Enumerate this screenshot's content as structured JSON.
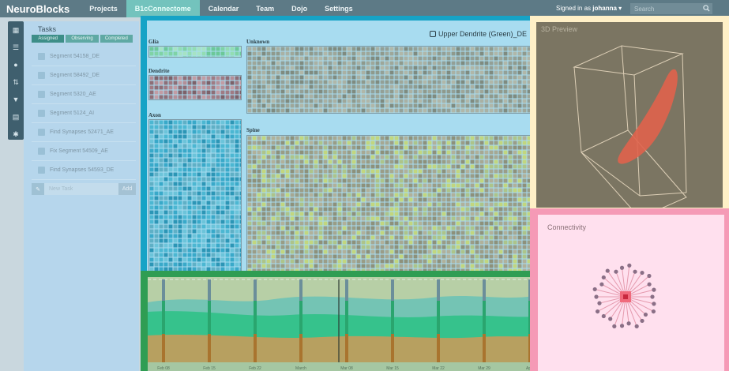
{
  "nav": {
    "brand": "NeuroBlocks",
    "items": [
      "Projects",
      "B1cConnectome",
      "Calendar",
      "Team",
      "Dojo",
      "Settings"
    ],
    "active": "B1cConnectome",
    "signed_in_prefix": "Signed in as",
    "user": "johanna",
    "search_placeholder": "Search"
  },
  "rail": {
    "icons": [
      "grid-icon",
      "list-icon",
      "drop-icon",
      "sort-icon",
      "filter-icon",
      "book-icon",
      "gear-icon"
    ]
  },
  "tasks": {
    "title": "Tasks",
    "tabs": [
      "Assigned",
      "Observing",
      "Completed"
    ],
    "active_tab": "Assigned",
    "items": [
      "Segment 54158_DE",
      "Segment 58492_DE",
      "Segment 5320_AE",
      "Segment 5124_AI",
      "Find Synapses 52471_AE",
      "Fix Segment 54509_AE",
      "Find Synapses 54593_DE"
    ],
    "new_task_placeholder": "New Task",
    "add_label": "Add"
  },
  "treemap": {
    "legend": "Upper Dendrite (Green)_DE",
    "groups": [
      "Glia",
      "Unknown",
      "Dendrite",
      "Axon",
      "Spine"
    ]
  },
  "timeline": {
    "dates": [
      "Feb 08",
      "Feb 15",
      "Feb 22",
      "March",
      "Mar 08",
      "Mar 15",
      "Mar 22",
      "Mar 29",
      "April"
    ]
  },
  "preview": {
    "title": "3D Preview"
  },
  "connectivity": {
    "title": "Connectivity"
  },
  "colors": {
    "nav": "#5d7a86",
    "accent": "#73c3bd",
    "treemap_frame": "#16a3c6",
    "timeline_frame": "#2f9d53",
    "preview_frame": "#fff0c7",
    "connectivity_frame": "#f59ab6"
  }
}
